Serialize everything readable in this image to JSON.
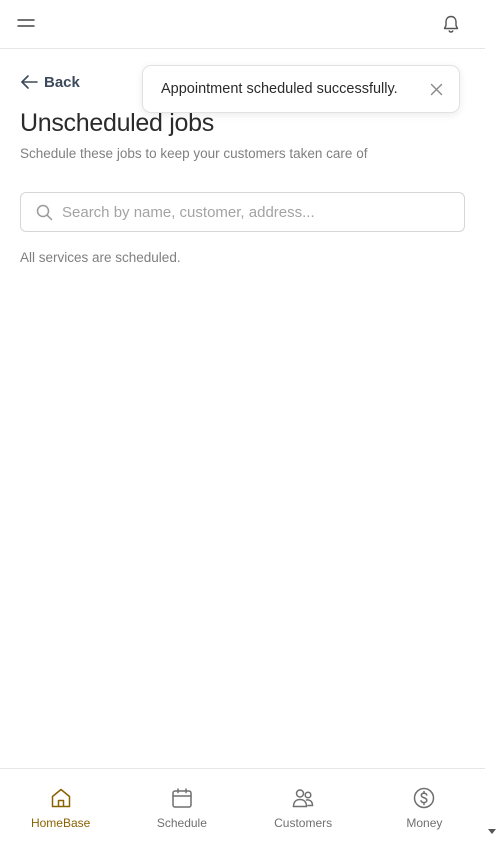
{
  "header": {
    "menu_icon": "hamburger-icon",
    "notification_icon": "bell-icon"
  },
  "back": {
    "label": "Back",
    "icon": "arrow-left-icon"
  },
  "page": {
    "title": "Unscheduled jobs",
    "subtitle": "Schedule these jobs to keep your customers taken care of",
    "empty_message": "All services are scheduled."
  },
  "search": {
    "placeholder": "Search by name, customer, address...",
    "value": ""
  },
  "toast": {
    "message": "Appointment scheduled successfully.",
    "close_icon": "close-icon"
  },
  "bottom_nav": {
    "items": [
      {
        "label": "HomeBase",
        "icon": "home-icon",
        "active": true
      },
      {
        "label": "Schedule",
        "icon": "calendar-icon",
        "active": false
      },
      {
        "label": "Customers",
        "icon": "users-icon",
        "active": false
      },
      {
        "label": "Money",
        "icon": "dollar-icon",
        "active": false
      }
    ]
  },
  "colors": {
    "accent": "#8a6200",
    "text": "#2b2b2b",
    "muted": "#808080",
    "back_link": "#3d4a5c"
  }
}
